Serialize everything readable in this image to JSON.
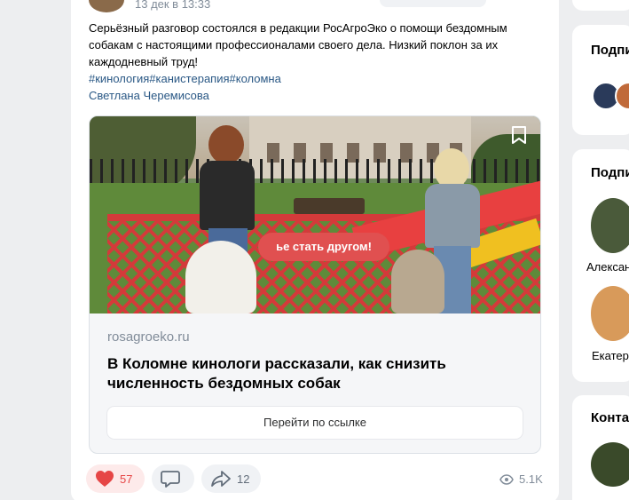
{
  "post": {
    "date": "13 дек в 13:33",
    "text": "Серьёзный разговор состоялся в редакции РосАгроЭко о помощи бездомным собакам с настоящими профессионалами своего дела. Низкий поклон за их каждодневный труд!",
    "hashtags": "#кинология#канистерапия#коломна",
    "author": "Светлана Черемисова"
  },
  "attachment": {
    "image_sign_text": "ье стать другом!",
    "domain": "rosagroeko.ru",
    "title": "В Коломне кинологи рассказали, как снизить численность бездомных собак",
    "button_label": "Перейти по ссылке"
  },
  "actions": {
    "likes": "57",
    "shares": "12",
    "views": "5.1K"
  },
  "sidebar": {
    "subscriptions_title": "Подпи",
    "subscribers_title": "Подпи",
    "contacts_title": "Конта",
    "person1_name": "Алексан",
    "person2_name": "Екатер"
  },
  "colors": {
    "like_active": "#e64646",
    "link": "#2a5885",
    "muted": "#818c99"
  }
}
